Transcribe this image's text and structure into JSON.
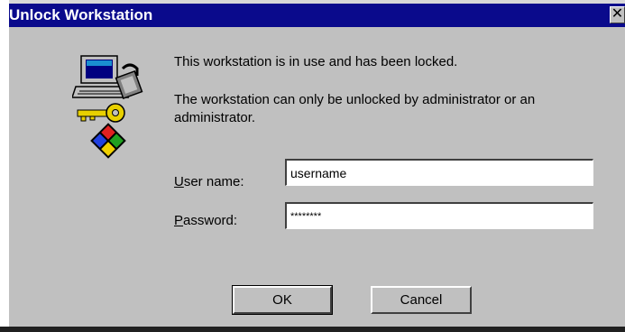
{
  "window": {
    "title": "Unlock Workstation",
    "close_glyph": "✕",
    "title_color": "#0a0a8c"
  },
  "icons": {
    "computer": "locked-computer-icon",
    "key": "key-icon"
  },
  "message": {
    "line1": "This workstation is in use and has been locked.",
    "line2": "The workstation can only be unlocked by administrator or an administrator."
  },
  "form": {
    "username_label_mnemonic": "U",
    "username_label_rest": "ser name:",
    "username_value": "username",
    "password_label_mnemonic": "P",
    "password_label_rest": "assword:",
    "password_value": "********"
  },
  "buttons": {
    "ok_label": "OK",
    "cancel_label": "Cancel"
  }
}
